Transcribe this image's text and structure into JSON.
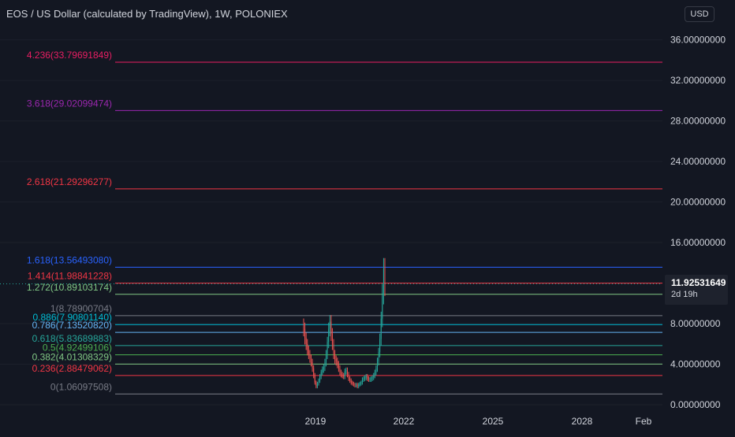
{
  "header": {
    "title": "EOS / US Dollar (calculated by TradingView), 1W, POLONIEX",
    "currency": "USD"
  },
  "price_badge": {
    "value": "11.92531649",
    "countdown": "2d 19h"
  },
  "chart_data": {
    "type": "line",
    "title": "EOS / US Dollar (calculated by TradingView), 1W, POLONIEX",
    "ylim": [
      0,
      37.2
    ],
    "y_ticks": [
      {
        "value": 0,
        "label": "0.00000000"
      },
      {
        "value": 4,
        "label": "4.00000000"
      },
      {
        "value": 8,
        "label": "8.00000000"
      },
      {
        "value": 16,
        "label": "16.00000000"
      },
      {
        "value": 20,
        "label": "20.00000000"
      },
      {
        "value": 24,
        "label": "24.00000000"
      },
      {
        "value": 28,
        "label": "28.00000000"
      },
      {
        "value": 32,
        "label": "32.00000000"
      },
      {
        "value": 36,
        "label": "36.00000000"
      }
    ],
    "x_ticks": [
      "2019",
      "2022",
      "2025",
      "2028",
      "Feb"
    ],
    "fib_levels": [
      {
        "label": "4.236(33.79691849)",
        "value": 33.79691849,
        "color": "#e91e63"
      },
      {
        "label": "3.618(29.02099474)",
        "value": 29.02099474,
        "color": "#9c27b0"
      },
      {
        "label": "2.618(21.29296277)",
        "value": 21.29296277,
        "color": "#f23645"
      },
      {
        "label": "1.618(13.56493080)",
        "value": 13.5649308,
        "color": "#2962ff"
      },
      {
        "label": "1.414(11.98841228)",
        "value": 11.98841228,
        "color": "#f23645"
      },
      {
        "label": "1.272(10.89103174)",
        "value": 10.89103174,
        "color": "#81c784"
      },
      {
        "label": "1(8.78900704)",
        "value": 8.78900704,
        "color": "#787b86"
      },
      {
        "label": "0.886(7.90801140)",
        "value": 7.9080114,
        "color": "#00bcd4"
      },
      {
        "label": "0.786(7.13520820)",
        "value": 7.1352082,
        "color": "#64b5f6"
      },
      {
        "label": "0.618(5.83689883)",
        "value": 5.83689883,
        "color": "#26a69a"
      },
      {
        "label": "0.5(4.92499106)",
        "value": 4.92499106,
        "color": "#4caf50"
      },
      {
        "label": "0.382(4.01308329)",
        "value": 4.01308329,
        "color": "#81c784"
      },
      {
        "label": "0.236(2.88479062)",
        "value": 2.88479062,
        "color": "#f23645"
      },
      {
        "label": "0(1.06097508)",
        "value": 1.06097508,
        "color": "#787b86"
      }
    ],
    "series": [
      {
        "type": "candlestick",
        "up_color": "#26a69a",
        "down_color": "#ef5350",
        "close": [
          7.5,
          6.6,
          6.0,
          5.4,
          5.0,
          4.6,
          4.2,
          3.6,
          2.9,
          2.2,
          1.8,
          2.1,
          2.4,
          2.8,
          3.2,
          3.5,
          3.7,
          4.2,
          5.0,
          6.2,
          7.5,
          8.2,
          7.0,
          6.0,
          5.0,
          4.5,
          4.3,
          4.0,
          3.6,
          3.2,
          3.0,
          2.9,
          2.8,
          3.3,
          3.4,
          3.0,
          2.6,
          2.4,
          2.2,
          2.1,
          2.0,
          1.9,
          2.0,
          1.8,
          2.0,
          2.1,
          2.2,
          2.5,
          2.6,
          2.7,
          2.8,
          2.6,
          2.5,
          2.5,
          2.6,
          2.7,
          2.9,
          3.2,
          3.6,
          4.3,
          5.2,
          6.5,
          8.5,
          11.0,
          13.4,
          11.925
        ]
      }
    ]
  }
}
